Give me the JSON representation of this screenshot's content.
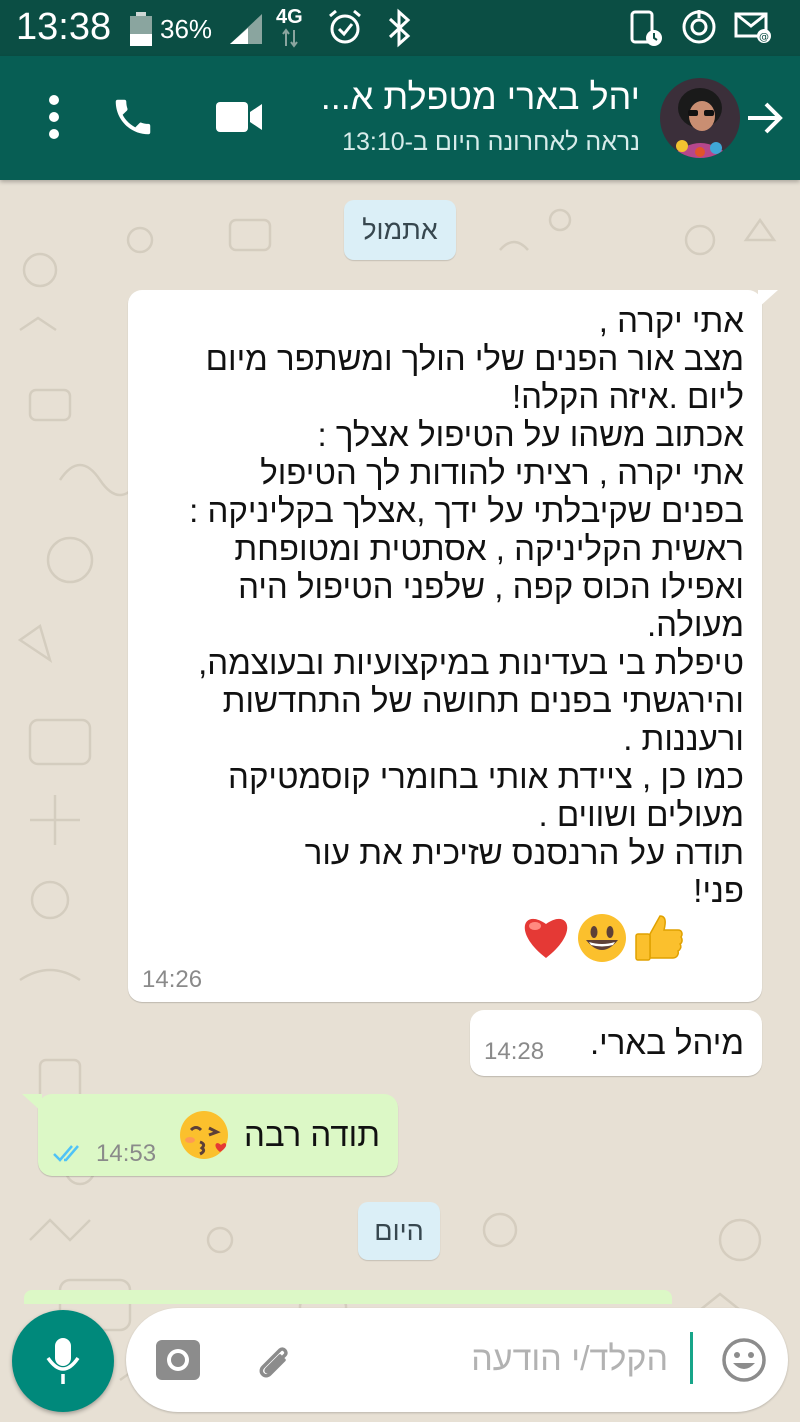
{
  "status_bar": {
    "time": "13:38",
    "battery": "36%",
    "network": "4G",
    "icons": [
      "battery-icon",
      "signal-icon",
      "alarm-icon",
      "bluetooth-icon",
      "sim-icon",
      "sync-icon",
      "mail-icon"
    ]
  },
  "header": {
    "contact_name": "יהל בארי מטפלת א...",
    "last_seen": "נראה לאחרונה היום ב-13:10",
    "icons": [
      "back-arrow-icon",
      "video-call-icon",
      "voice-call-icon",
      "more-options-icon"
    ]
  },
  "chat": {
    "date_yesterday": "אתמול",
    "date_today": "היום",
    "messages": [
      {
        "direction": "incoming",
        "text": "אתי יקרה ,\nמצב אור הפנים שלי הולך ומשתפר מיום\nליום .איזה הקלה!\nאכתוב משהו על הטיפול אצלך :\nאתי יקרה , רציתי להודות לך הטיפול\nבפנים שקיבלתי על ידך ,אצלך בקליניקה :\nראשית הקליניקה , אסתטית ומטופחת\nואפילו הכוס קפה , שלפני הטיפול היה\nמעולה.\nטיפלת בי בעדינות במיקצועיות ובעוצמה,\nוהירגשתי בפנים תחושה של התחדשות\nורעננות .\nכמו כן , ציידת אותי  בחומרי קוסמטיקה\nמעולים ושווים .\nתודה על הרנסנס שזיכית את עור\nפני!",
        "emoji": [
          "thumbs-up-emoji",
          "grinning-face-emoji",
          "red-heart-emoji"
        ],
        "time": "14:26"
      },
      {
        "direction": "incoming",
        "text": "מיהל בארי.",
        "time": "14:28"
      },
      {
        "direction": "outgoing",
        "text": "תודה רבה",
        "emoji": [
          "face-blowing-kiss-emoji"
        ],
        "time": "14:53",
        "read_receipt": "double-check-blue"
      }
    ]
  },
  "composer": {
    "placeholder": "הקלד/י הודעה",
    "icons": [
      "emoji-icon",
      "attach-icon",
      "camera-icon",
      "mic-icon"
    ]
  },
  "colors": {
    "status_bar": "#0b4e44",
    "app_bar": "#075e54",
    "incoming_bubble": "#ffffff",
    "outgoing_bubble": "#dcf8c6",
    "date_chip": "#dbeff7",
    "wallpaper": "#e7e0d4",
    "mic_button": "#00897b",
    "read_tick": "#4fc3f7"
  }
}
